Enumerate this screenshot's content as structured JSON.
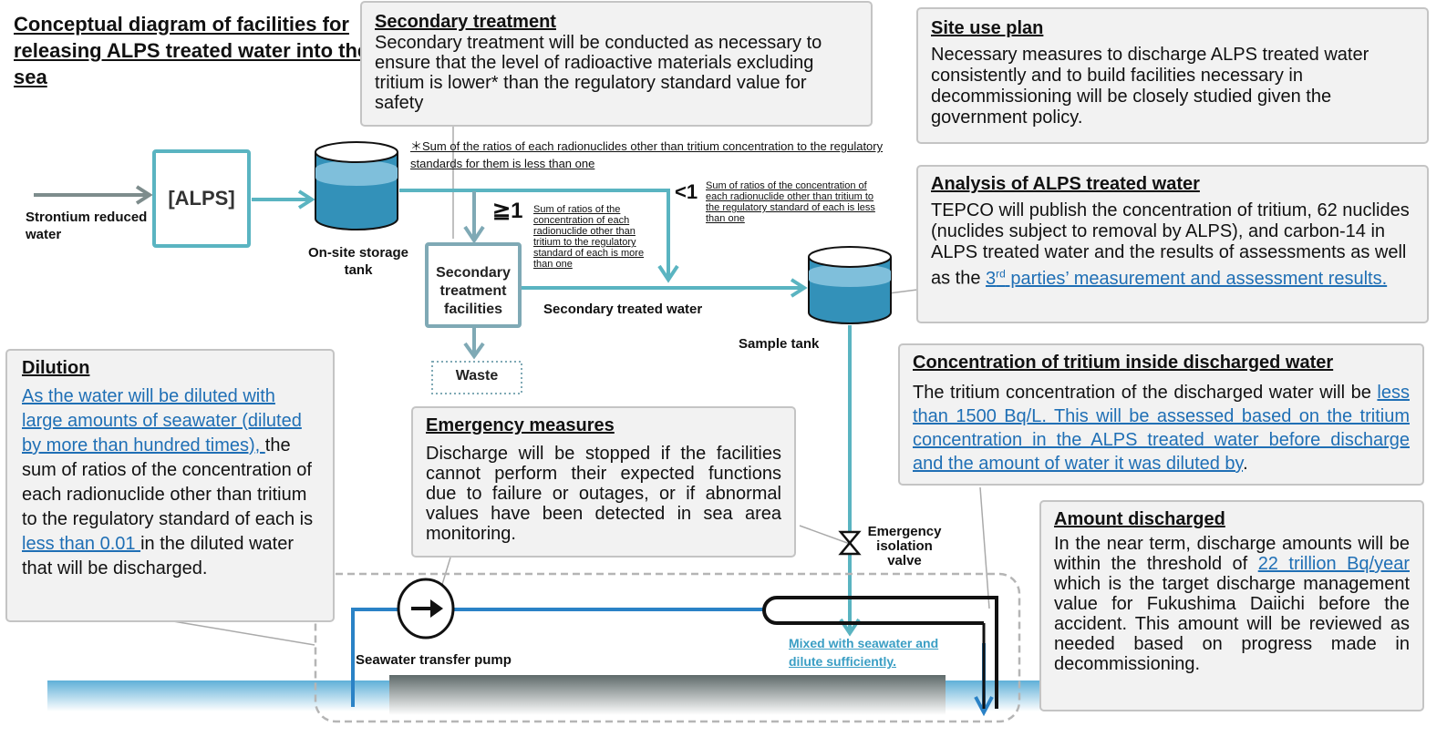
{
  "title": "Conceptual diagram of facilities for releasing ALPS treated water into the sea",
  "colors": {
    "flow": "#5ab4c1",
    "secondary_flow": "#7fa9b5",
    "seawater_pipe": "#2a82c6",
    "link_text": "#1f6fb5",
    "tank_water": "#3391b9",
    "callout_bg": "#f2f2f2",
    "callout_border": "#c4c4c4"
  },
  "nodes": {
    "input_label": "Strontium reduced water",
    "alps": "[ALPS]",
    "storage_tank": "On-site storage tank",
    "secondary_facility": "Secondary treatment facilities",
    "waste": "Waste",
    "secondary_treated_water": "Secondary treated water",
    "sample_tank": "Sample tank",
    "valve": "Emergency isolation valve",
    "pump": "Seawater transfer pump",
    "mix_label": "Mixed with seawater and dilute sufficiently."
  },
  "branch": {
    "ge1_symbol": "≧1",
    "ge1_text": "Sum of ratios of the concentration of each radionuclide other than tritium to the regulatory standard of each is more than one",
    "lt1_symbol": "<1",
    "lt1_text": "Sum of ratios of the concentration of each radionuclide other than tritium to the regulatory standard of each is less than one",
    "footnote": "＊Sum of the ratios of each radionuclides other than tritium concentration to the regulatory standards for them is less than one"
  },
  "callouts": {
    "secondary_treatment": {
      "title": "Secondary treatment",
      "body": "Secondary treatment will be conducted as necessary to ensure that the level of radioactive materials excluding tritium is lower* than the regulatory standard value  for safety"
    },
    "site_use": {
      "title": "Site use plan",
      "body": "Necessary measures to discharge ALPS treated water consistently and to build facilities necessary in decommissioning will be closely studied given the government policy."
    },
    "analysis": {
      "title": "Analysis of ALPS treated water",
      "body": "TEPCO will publish the concentration of tritium, 62 nuclides (nuclides subject to removal by ALPS), and carbon-14 in ALPS treated water and the results of assessments as well as the ",
      "link_pre": "3",
      "link_sup": "rd",
      "link": " parties’ measurement and assessment results."
    },
    "tritium_concentration": {
      "title": "Concentration of tritium inside discharged water",
      "body": "The tritium concentration of the discharged water will be ",
      "link": "less than 1500 Bq/L. This will be assessed based on the tritium concentration in the ALPS treated water before discharge and the amount of water it was diluted by",
      "tail": "."
    },
    "dilution": {
      "title": "Dilution",
      "link1": "As the water will be diluted with large amounts of seawater (diluted by more than hundred times), ",
      "body1": "the sum of ratios of the concentration of each radionuclide other than tritium to the regulatory standard of each is ",
      "link2": "less than 0.01 ",
      "body2": "in the diluted water that will be discharged."
    },
    "emergency": {
      "title": "Emergency measures",
      "body": "Discharge will be stopped if the facilities cannot perform their expected functions due to failure or outages, or if abnormal values have been detected in sea area monitoring."
    },
    "amount": {
      "title": "Amount discharged",
      "body1": "In the near term, discharge amounts will be within the threshold of ",
      "link": "22 trillion Bq/year",
      "body2": " which is the target discharge management value for Fukushima Daiichi before the accident. This amount will be reviewed as needed based on progress made in decommissioning."
    }
  }
}
